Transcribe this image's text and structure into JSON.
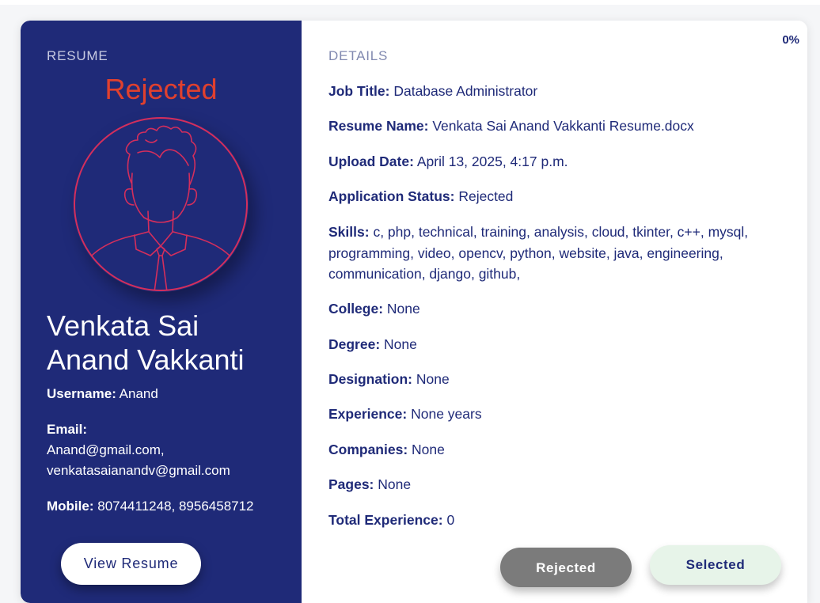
{
  "left_panel": {
    "section_label": "RESUME",
    "status_heading": "Rejected",
    "avatar_icon": "user-avatar-icon",
    "candidate_name": "Venkata Sai Anand Vakkanti",
    "username_label": "Username:",
    "username_value": "Anand",
    "email_label": "Email:",
    "email_value": "Anand@gmail.com, venkatasaianandv@gmail.com",
    "mobile_label": "Mobile:",
    "mobile_value": "8074411248, 8956458712",
    "view_resume_label": "View Resume"
  },
  "right_panel": {
    "section_label": "DETAILS",
    "match_percent": "0%",
    "fields": [
      {
        "label": "Job Title:",
        "value": "Database Administrator"
      },
      {
        "label": "Resume Name:",
        "value": "Venkata Sai Anand Vakkanti Resume.docx"
      },
      {
        "label": "Upload Date:",
        "value": "April 13, 2025, 4:17 p.m."
      },
      {
        "label": "Application Status:",
        "value": "Rejected"
      },
      {
        "label": "Skills:",
        "value": "c, php, technical, training, analysis, cloud, tkinter, c++, mysql, programming, video, opencv, python, website, java, engineering, communication, django, github,"
      },
      {
        "label": "College:",
        "value": "None"
      },
      {
        "label": "Degree:",
        "value": "None"
      },
      {
        "label": "Designation:",
        "value": "None"
      },
      {
        "label": "Experience:",
        "value": "None years"
      },
      {
        "label": "Companies:",
        "value": "None"
      },
      {
        "label": "Pages:",
        "value": "None"
      },
      {
        "label": "Total Experience:",
        "value": "0"
      }
    ],
    "rejected_button_label": "Rejected",
    "selected_button_label": "Selected"
  },
  "colors": {
    "panel_navy": "#1f2a78",
    "status_red": "#e0402e",
    "avatar_line": "#d42e5c",
    "rejected_gray": "#7b7b7b",
    "selected_green": "#e7f4e9"
  }
}
